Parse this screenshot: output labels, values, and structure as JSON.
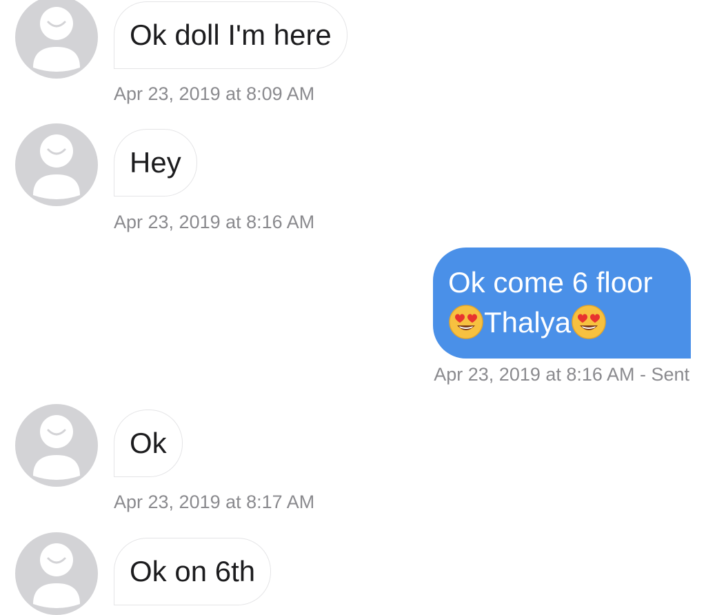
{
  "messages": [
    {
      "direction": "incoming",
      "text": "Ok doll I'm here",
      "timestamp": "Apr 23, 2019 at 8:09 AM"
    },
    {
      "direction": "incoming",
      "text": "Hey",
      "timestamp": "Apr 23, 2019 at 8:16 AM"
    },
    {
      "direction": "outgoing",
      "text_line1": "Ok come 6 floor",
      "text_line2": "Thalya",
      "emoji": "heart-eyes-emoji",
      "timestamp": "Apr 23, 2019 at 8:16 AM - Sent"
    },
    {
      "direction": "incoming",
      "text": "Ok",
      "timestamp": "Apr 23, 2019 at 8:17 AM"
    },
    {
      "direction": "incoming",
      "text": "Ok on 6th"
    }
  ],
  "avatar_icon": "default-person-avatar-icon",
  "colors": {
    "outgoing_bubble": "#4a90e8",
    "incoming_bubble_border": "#e4e4e6",
    "timestamp": "#8a8a8e",
    "avatar": "#d3d3d6"
  }
}
